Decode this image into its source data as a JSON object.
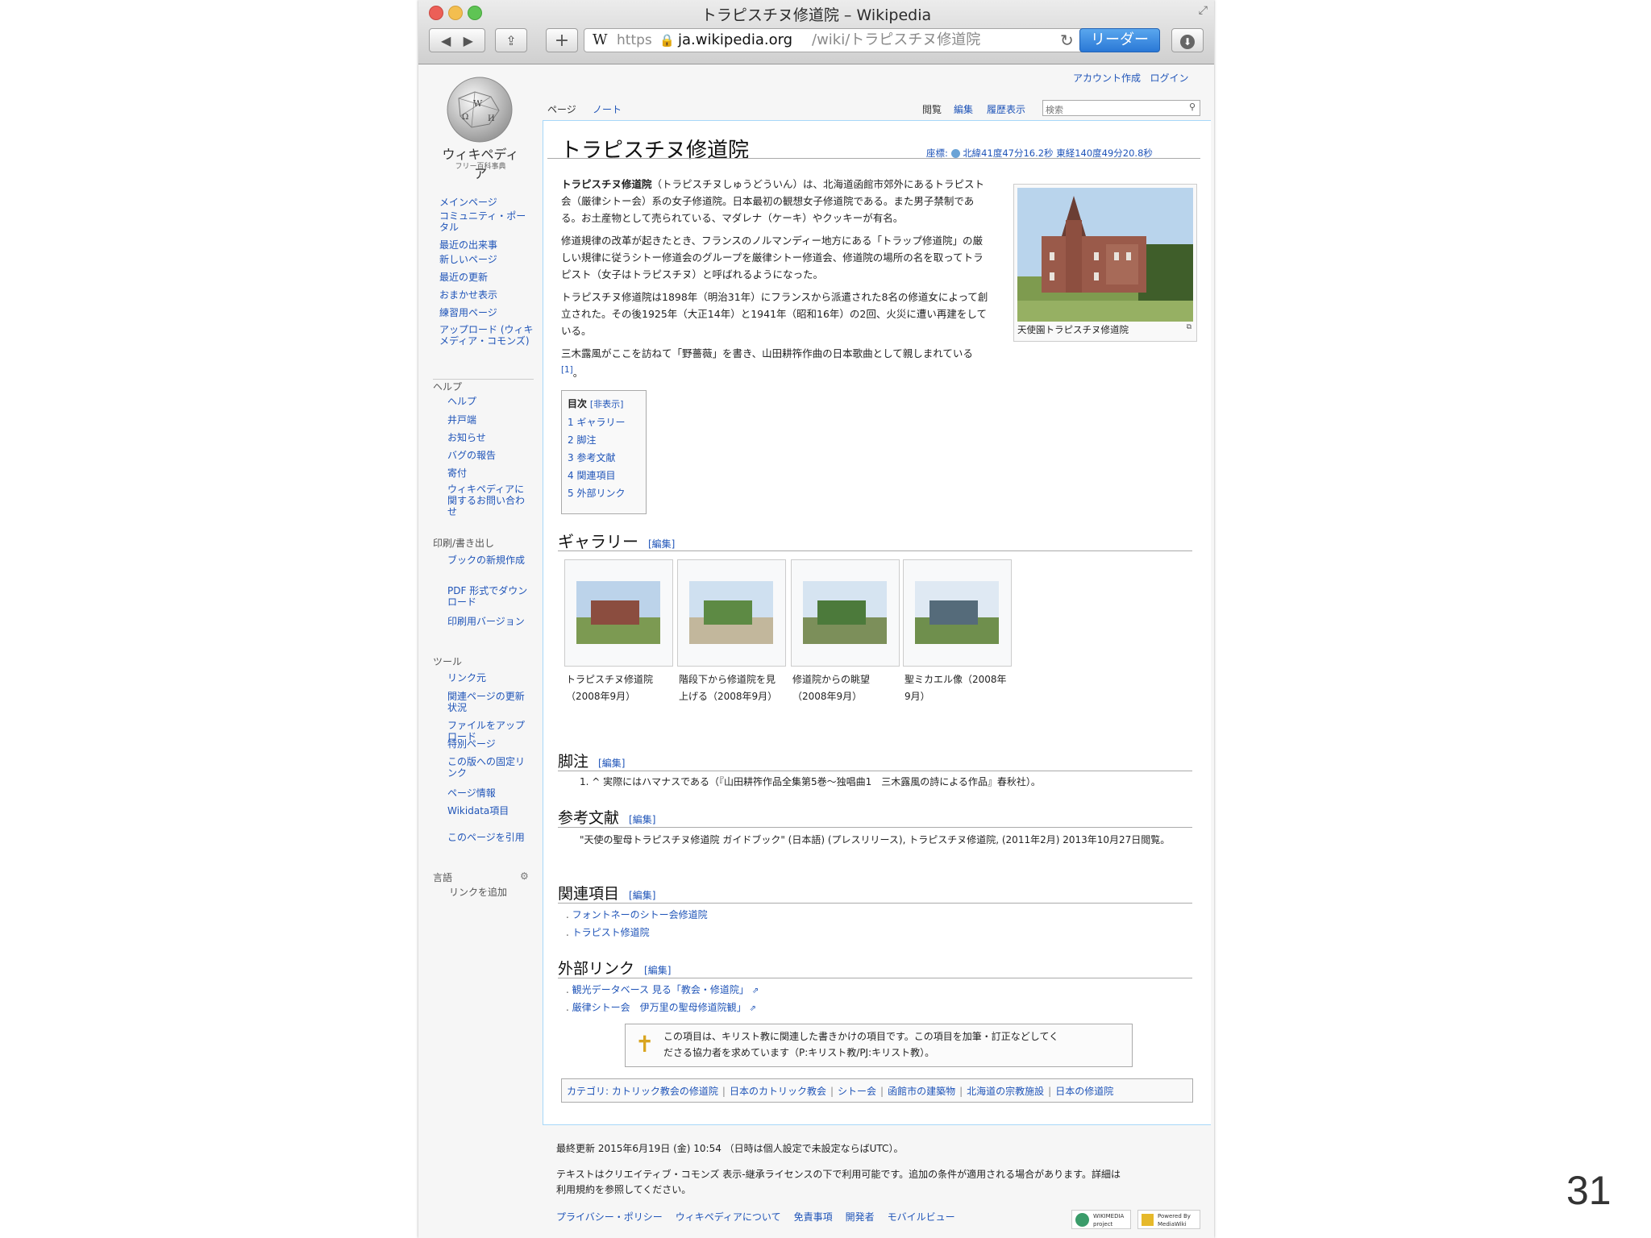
{
  "window": {
    "title": "トラピスチヌ修道院 – Wikipedia"
  },
  "toolbar": {
    "url_scheme": "https",
    "url_domain": "ja.wikipedia.org",
    "url_path": "/wiki/トラピスチヌ修道院",
    "reader_label": "リーダー",
    "add_label": "+",
    "favicon": "W"
  },
  "personal": {
    "create_account": "アカウント作成",
    "login": "ログイン"
  },
  "logo": {
    "name": "ウィキペディア",
    "tagline": "フリー百科事典"
  },
  "tabs": {
    "page": "ページ",
    "talk": "ノート",
    "read": "閲覧",
    "edit": "編集",
    "history": "履歴表示"
  },
  "search": {
    "placeholder": "検索"
  },
  "sidebar": {
    "nav": [
      "メインページ",
      "コミュニティ・ポータル",
      "最近の出来事",
      "新しいページ",
      "最近の更新",
      "おまかせ表示",
      "練習用ページ",
      "アップロード (ウィキメディア・コモンズ)"
    ],
    "help_heading": "ヘルプ",
    "help": [
      "ヘルプ",
      "井戸端",
      "お知らせ",
      "バグの報告",
      "寄付",
      "ウィキペディアに関するお問い合わせ"
    ],
    "print_heading": "印刷/書き出し",
    "print": [
      "ブックの新規作成",
      "PDF 形式でダウンロード",
      "印刷用バージョン"
    ],
    "tools_heading": "ツール",
    "tools": [
      "リンク元",
      "関連ページの更新状況",
      "ファイルをアップロード",
      "特別ページ",
      "この版への固定リンク",
      "ページ情報",
      "Wikidata項目",
      "このページを引用"
    ],
    "lang_heading": "言語",
    "lang_link": "リンクを追加"
  },
  "article": {
    "title": "トラピスチヌ修道院",
    "coords": "北緯41度47分16.2秒 東経140度49分20.8秒",
    "coords_label": "座標:",
    "p1a": "トラピスチヌ修道院",
    "p1b": "（トラピスチヌしゅうどういん）は、北海道函館市郊外にあるトラピスト会（厳律シトー会）系の女子修道院。日本最初の観想女子修道院である。また男子禁制である。お土産物として売られている、マダレナ（ケーキ）やクッキーが有名。",
    "p2": "修道規律の改革が起きたとき、フランスのノルマンディー地方にある「トラップ修道院」の厳しい規律に従うシトー修道会のグループを厳律シトー修道会、修道院の場所の名を取ってトラピスト（女子はトラピスチヌ）と呼ばれるようになった。",
    "p3": "トラピスチヌ修道院は1898年（明治31年）にフランスから派遣された8名の修道女によって創立された。その後1925年（大正14年）と1941年（昭和16年）の2回、火災に遭い再建をしている。",
    "p4": "三木露風がここを訪ねて「野薔薇」を書き、山田耕筰作曲の日本歌曲として親しまれている",
    "p4_ref": "[1]",
    "infobox_caption": "天使園トラピスチヌ修道院"
  },
  "toc": {
    "title": "目次",
    "toggle": "[非表示]",
    "items": [
      "1 ギャラリー",
      "2 脚注",
      "3 参考文献",
      "4 関連項目",
      "5 外部リンク"
    ]
  },
  "sections": {
    "gallery": "ギャラリー",
    "notes": "脚注",
    "refs": "参考文献",
    "related": "関連項目",
    "external": "外部リンク",
    "edit_label": "[編集]"
  },
  "gallery": [
    {
      "caption": "トラピスチヌ修道院（2008年9月）"
    },
    {
      "caption": "階段下から修道院を見上げる（2008年9月）"
    },
    {
      "caption": "修道院からの眺望（2008年9月）"
    },
    {
      "caption": "聖ミカエル像（2008年9月）"
    }
  ],
  "notes": {
    "item": "1. ^ 実際にはハマナスである（『山田耕筰作品全集第5巻〜独唱曲1　三木露風の詩による作品』春秋社）。"
  },
  "refs": {
    "item": "\"天使の聖母トラピスチヌ修道院 ガイドブック\" (日本語) (プレスリリース), トラピスチヌ修道院, (2011年2月) 2013年10月27日閲覧。"
  },
  "related": [
    "フォントネーのシトー会修道院",
    "トラピスト修道院"
  ],
  "external": [
    "観光データベース 見る「教会・修道院」",
    "厳律シトー会　伊万里の聖母修道院観」"
  ],
  "stub": {
    "line1": "この項目は、キリスト教に関連した書きかけの項目です。この項目を加筆・訂正などしてく",
    "line2": "ださる協力者を求めています（P:キリスト教/PJ:キリスト教）。"
  },
  "categories": {
    "label": "カテゴリ:",
    "items": [
      "カトリック教会の修道院",
      "日本のカトリック教会",
      "シトー会",
      "函館市の建築物",
      "北海道の宗教施設",
      "日本の修道院"
    ]
  },
  "footer": {
    "lastmod": "最終更新 2015年6月19日 (金) 10:54 （日時は個人設定で未設定ならばUTC）。",
    "license1": "テキストはクリエイティブ・コモンズ 表示-継承ライセンスの下で利用可能です。追加の条件が適用される場合があります。詳細は",
    "license2": "利用規約を参照してください。",
    "links": [
      "プライバシー・ポリシー",
      "ウィキペディアについて",
      "免責事項",
      "開発者",
      "モバイルビュー"
    ],
    "badge1": "WIKIMEDIA project",
    "badge2": "Powered By MediaWiki"
  },
  "slide": {
    "page_number": "31"
  }
}
